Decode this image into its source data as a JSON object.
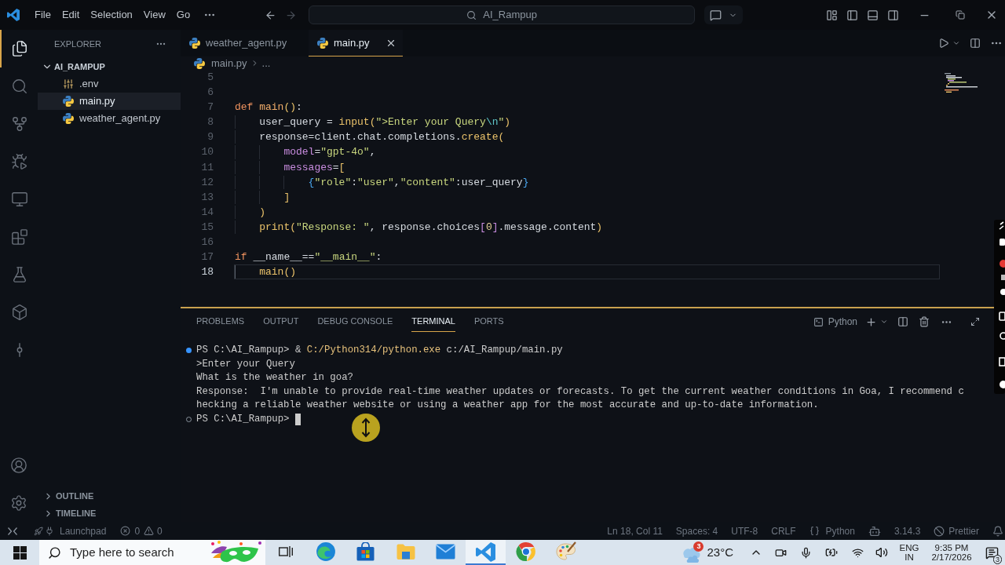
{
  "title_bar": {
    "menu": [
      "File",
      "Edit",
      "Selection",
      "View",
      "Go"
    ],
    "navigation": {
      "back": {
        "disabled": false
      },
      "forward": {
        "disabled": true
      }
    },
    "search": "AI_Rampup"
  },
  "activity_bar": [
    {
      "selected": true
    },
    {
      "selected": false
    },
    {
      "selected": false
    },
    {
      "selected": false
    },
    {
      "selected": false
    },
    {
      "selected": false
    },
    {
      "selected": false
    },
    {
      "selected": false
    },
    {
      "selected": false
    }
  ],
  "explorer": {
    "title": "EXPLORER",
    "folder": {
      "name": "AI_RAMPUP",
      "expanded": true,
      "files": [
        {
          "name": ".env",
          "kind": "config",
          "selected": false
        },
        {
          "name": "main.py",
          "kind": "python",
          "selected": true
        },
        {
          "name": "weather_agent.py",
          "kind": "python",
          "selected": false
        }
      ]
    },
    "sections": [
      {
        "name": "OUTLINE",
        "expanded": false
      },
      {
        "name": "TIMELINE",
        "expanded": false
      }
    ]
  },
  "editor": {
    "tabs": [
      {
        "label": "weather_agent.py",
        "selected": false
      },
      {
        "label": "main.py",
        "selected": true
      }
    ],
    "breadcrumbs": [
      "main.py",
      "..."
    ],
    "lines": [
      {
        "number": "5",
        "current": false
      },
      {
        "number": "6",
        "current": false
      },
      {
        "number": "7",
        "current": false,
        "tokens": [
          {
            "kind": "keyword",
            "text": "def"
          },
          {
            "kind": "function_def",
            "text": " main"
          },
          {
            "kind": "bracket_1",
            "text": "()"
          },
          {
            "kind": "plain",
            "text": ":"
          }
        ],
        "children": [
          {
            "number": "8",
            "current": false,
            "tokens": [
              {
                "kind": "plain",
                "text": "user_query = "
              },
              {
                "kind": "function",
                "text": "input"
              },
              {
                "kind": "bracket_1",
                "text": "("
              },
              {
                "kind": "string",
                "text": "\">Enter your Query"
              },
              {
                "kind": "escape",
                "text": "\\n"
              },
              {
                "kind": "string",
                "text": "\""
              },
              {
                "kind": "bracket_1",
                "text": ")"
              }
            ]
          },
          {
            "number": "9",
            "current": false,
            "tokens": [
              {
                "kind": "plain",
                "text": "response=client.chat.completions."
              },
              {
                "kind": "function",
                "text": "create"
              },
              {
                "kind": "bracket_1",
                "text": "("
              }
            ],
            "children": [
              {
                "number": "10",
                "current": false,
                "tokens": [
                  {
                    "kind": "parameter",
                    "text": "model"
                  },
                  {
                    "kind": "plain",
                    "text": "="
                  },
                  {
                    "kind": "string",
                    "text": "\"gpt-4o\""
                  },
                  {
                    "kind": "plain",
                    "text": ","
                  }
                ]
              },
              {
                "number": "11",
                "current": false,
                "tokens": [
                  {
                    "kind": "parameter",
                    "text": "messages"
                  },
                  {
                    "kind": "plain",
                    "text": "="
                  },
                  {
                    "kind": "bracket_1",
                    "text": "["
                  }
                ],
                "children": [
                  {
                    "number": "12",
                    "current": false,
                    "tokens": [
                      {
                        "kind": "bracket_3",
                        "text": "{"
                      },
                      {
                        "kind": "string",
                        "text": "\"role\""
                      },
                      {
                        "kind": "plain",
                        "text": ":"
                      },
                      {
                        "kind": "string",
                        "text": "\"user\""
                      },
                      {
                        "kind": "plain",
                        "text": ","
                      },
                      {
                        "kind": "string",
                        "text": "\"content\""
                      },
                      {
                        "kind": "plain",
                        "text": ":user_query"
                      },
                      {
                        "kind": "bracket_3",
                        "text": "}"
                      }
                    ]
                  }
                ]
              },
              {
                "number": "13",
                "current": false,
                "tokens": [
                  {
                    "kind": "bracket_1",
                    "text": "]"
                  }
                ]
              }
            ]
          },
          {
            "number": "14",
            "current": false,
            "tokens": [
              {
                "kind": "bracket_1",
                "text": ")"
              }
            ]
          },
          {
            "number": "15",
            "current": false,
            "tokens": [
              {
                "kind": "function",
                "text": "print"
              },
              {
                "kind": "bracket_1",
                "text": "("
              },
              {
                "kind": "string",
                "text": "\"Response: \""
              },
              {
                "kind": "plain",
                "text": ", response.choices"
              },
              {
                "kind": "bracket_2",
                "text": "["
              },
              {
                "kind": "number",
                "text": "0"
              },
              {
                "kind": "bracket_2",
                "text": "]"
              },
              {
                "kind": "plain",
                "text": ".message.content"
              },
              {
                "kind": "bracket_1",
                "text": ")"
              }
            ]
          }
        ]
      },
      {
        "number": "16",
        "current": false
      },
      {
        "number": "17",
        "current": false,
        "tokens": [
          {
            "kind": "keyword",
            "text": "if"
          },
          {
            "kind": "plain",
            "text": " __name__=="
          },
          {
            "kind": "string",
            "text": "\"__main__\""
          },
          {
            "kind": "plain",
            "text": ":"
          }
        ],
        "children": [
          {
            "number": "18",
            "current": true,
            "tokens": [
              {
                "kind": "function",
                "text": "main"
              },
              {
                "kind": "bracket_1",
                "text": "()"
              }
            ]
          }
        ]
      }
    ]
  },
  "panel": {
    "tabs": [
      {
        "label": "PROBLEMS",
        "selected": false
      },
      {
        "label": "OUTPUT",
        "selected": false
      },
      {
        "label": "DEBUG CONSOLE",
        "selected": false
      },
      {
        "label": "TERMINAL",
        "selected": true
      },
      {
        "label": "PORTS",
        "selected": false
      }
    ],
    "terminal_name": "Python",
    "terminal": [
      {
        "kind": "command",
        "finished": true,
        "prompt": "PS C:\\AI_Rampup>",
        "operator": "&",
        "program": "C:/Python314/python.exe",
        "args": "c:/AI_Rampup/main.py"
      },
      {
        "kind": "output",
        "text": ">Enter your Query"
      },
      {
        "kind": "output",
        "text": "What is the weather in goa?"
      },
      {
        "kind": "output",
        "text": "Response:  I'm unable to provide real-time weather updates or forecasts. To get the current weather conditions in Goa, I recommend c"
      },
      {
        "kind": "output",
        "text": "hecking a reliable weather website or using a weather app for the most accurate and up-to-date information."
      },
      {
        "kind": "prompt",
        "finished": false,
        "prompt": "PS C:\\AI_Rampup>",
        "cursor": true
      }
    ]
  },
  "status_bar": {
    "launchpad": "Launchpad",
    "errors": "0",
    "warnings": "0",
    "items": [
      {
        "kind": "text",
        "text": "Ln 18, Col 11"
      },
      {
        "kind": "text",
        "text": "Spaces: 4"
      },
      {
        "kind": "text",
        "text": "UTF-8"
      },
      {
        "kind": "text",
        "text": "CRLF"
      },
      {
        "kind": "language",
        "text": "Python"
      },
      {
        "kind": "copilot"
      },
      {
        "kind": "text",
        "text": "3.14.3"
      },
      {
        "kind": "formatter",
        "text": "Prettier"
      },
      {
        "kind": "bell"
      }
    ]
  },
  "taskbar": {
    "search_placeholder": "Type here to search",
    "apps": [
      {
        "selected": false
      },
      {
        "selected": false
      },
      {
        "selected": false
      },
      {
        "selected": false
      },
      {
        "selected": false
      },
      {
        "selected": true
      },
      {
        "selected": false
      },
      {
        "selected": false
      }
    ],
    "weather": {
      "badge": "3",
      "temperature": "23°C"
    },
    "language": "ENG",
    "region": "IN",
    "time": "9:35 PM",
    "date": "2/17/2026",
    "notifications": "3"
  }
}
